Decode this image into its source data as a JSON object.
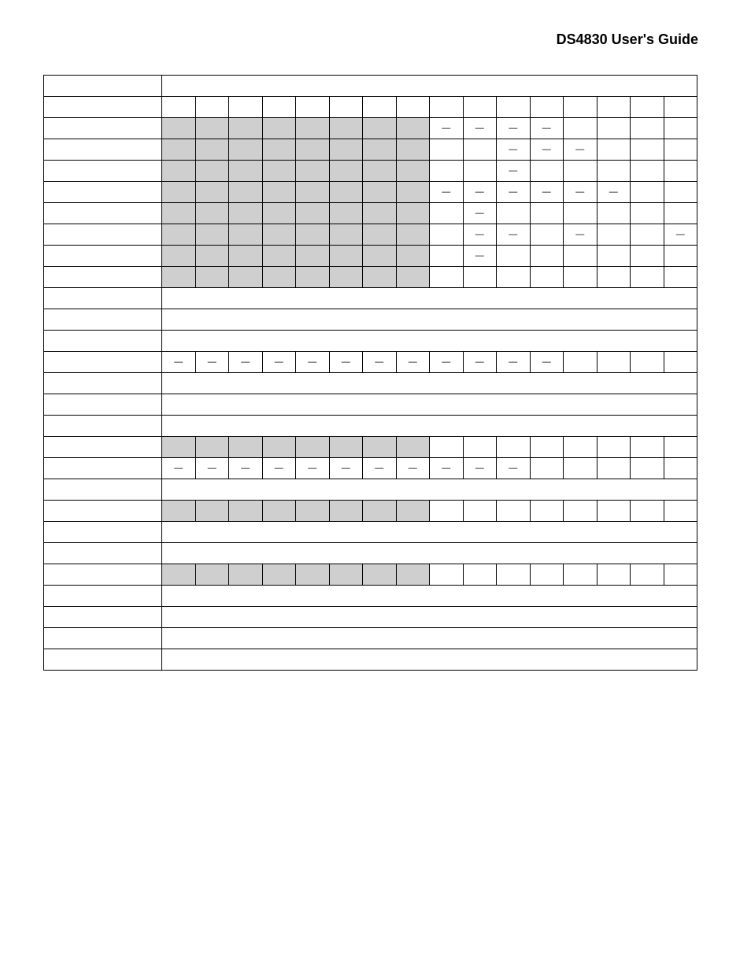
{
  "header": {
    "title": "DS4830 User's Guide"
  },
  "dash": "—",
  "table": {
    "header_row": {
      "name": "",
      "span16": ""
    },
    "bit_row": {
      "name": "",
      "cells": [
        "",
        "",
        "",
        "",
        "",
        "",
        "",
        "",
        "",
        "",
        "",
        "",
        "",
        "",
        "",
        ""
      ]
    },
    "rows": [
      {
        "name": "",
        "shaded": "0-7",
        "cells": [
          null,
          null,
          null,
          null,
          null,
          null,
          null,
          null,
          "—",
          "—",
          "—",
          "—",
          "",
          "",
          "",
          ""
        ]
      },
      {
        "name": "",
        "shaded": "0-7",
        "cells": [
          null,
          null,
          null,
          null,
          null,
          null,
          null,
          null,
          "",
          "",
          "—",
          "—",
          "—",
          "",
          "",
          ""
        ]
      },
      {
        "name": "",
        "shaded": "0-7",
        "cells": [
          null,
          null,
          null,
          null,
          null,
          null,
          null,
          null,
          "",
          "",
          "—",
          "",
          "",
          "",
          "",
          ""
        ]
      },
      {
        "name": "",
        "shaded": "0-7",
        "cells": [
          null,
          null,
          null,
          null,
          null,
          null,
          null,
          null,
          "—",
          "—",
          "—",
          "—",
          "—",
          "—",
          "",
          ""
        ]
      },
      {
        "name": "",
        "shaded": "0-7",
        "cells": [
          null,
          null,
          null,
          null,
          null,
          null,
          null,
          null,
          "",
          "—",
          "",
          "",
          "",
          "",
          "",
          ""
        ]
      },
      {
        "name": "",
        "shaded": "0-7",
        "cells": [
          null,
          null,
          null,
          null,
          null,
          null,
          null,
          null,
          "",
          "—",
          "—",
          "",
          "—",
          "",
          "",
          "—"
        ]
      },
      {
        "name": "",
        "shaded": "0-7",
        "cells": [
          null,
          null,
          null,
          null,
          null,
          null,
          null,
          null,
          "",
          "—",
          "",
          "",
          "",
          "",
          "",
          ""
        ]
      },
      {
        "name": "",
        "shaded": "0-7",
        "cells": [
          null,
          null,
          null,
          null,
          null,
          null,
          null,
          null,
          "",
          "",
          "",
          "",
          "",
          "",
          "",
          ""
        ]
      },
      {
        "name": "",
        "shaded": "none",
        "span16": ""
      },
      {
        "name": "",
        "shaded": "none",
        "span16": ""
      },
      {
        "name": "",
        "shaded": "none",
        "span16": ""
      },
      {
        "name": "",
        "shaded": "none",
        "cells": [
          "—",
          "—",
          "—",
          "—",
          "—",
          "—",
          "—",
          "—",
          "—",
          "—",
          "—",
          "—",
          "",
          "",
          "",
          ""
        ]
      },
      {
        "name": "",
        "shaded": "none",
        "span16": ""
      },
      {
        "name": "",
        "shaded": "none",
        "span16": ""
      },
      {
        "name": "",
        "shaded": "none",
        "span16": ""
      },
      {
        "name": "",
        "shaded": "0-7",
        "cells": [
          null,
          null,
          null,
          null,
          null,
          null,
          null,
          null,
          "",
          "",
          "",
          "",
          "",
          "",
          "",
          ""
        ]
      },
      {
        "name": "",
        "shaded": "none",
        "cells": [
          "—",
          "—",
          "—",
          "—",
          "—",
          "—",
          "—",
          "—",
          "—",
          "—",
          "—",
          "",
          "",
          "",
          "",
          ""
        ]
      },
      {
        "name": "",
        "shaded": "none",
        "span16": ""
      },
      {
        "name": "",
        "shaded": "0-7",
        "cells": [
          null,
          null,
          null,
          null,
          null,
          null,
          null,
          null,
          "",
          "",
          "",
          "",
          "",
          "",
          "",
          ""
        ]
      },
      {
        "name": "",
        "shaded": "none",
        "span16": ""
      },
      {
        "name": "",
        "shaded": "none",
        "span16": ""
      },
      {
        "name": "",
        "shaded": "0-7",
        "cells": [
          null,
          null,
          null,
          null,
          null,
          null,
          null,
          null,
          "",
          "",
          "",
          "",
          "",
          "",
          "",
          ""
        ]
      },
      {
        "name": "",
        "shaded": "none",
        "span16": ""
      },
      {
        "name": "",
        "shaded": "none",
        "span16": ""
      },
      {
        "name": "",
        "shaded": "none",
        "span16": ""
      },
      {
        "name": "",
        "shaded": "none",
        "span16": ""
      }
    ]
  }
}
